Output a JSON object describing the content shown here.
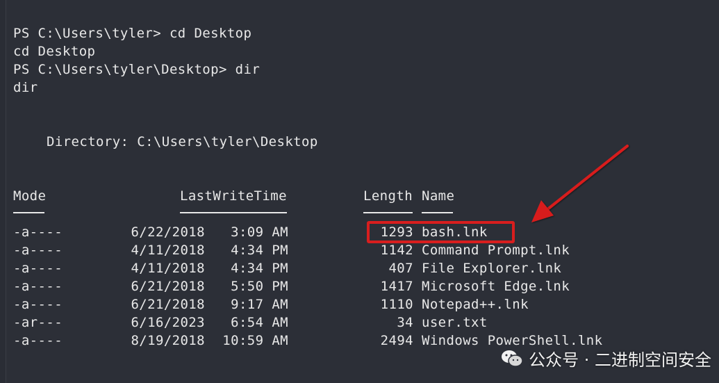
{
  "terminal": {
    "lines": [
      "PS C:\\Users\\tyler> cd Desktop",
      "cd Desktop",
      "PS C:\\Users\\tyler\\Desktop> dir",
      "dir",
      "Directory: C:\\Users\\tyler\\Desktop"
    ],
    "headers": {
      "mode": "Mode",
      "lastwrite": "LastWriteTime",
      "length": "Length",
      "name": "Name"
    },
    "rows": [
      {
        "mode": "-a----",
        "date": "6/22/2018",
        "time": "3:09 AM",
        "length": "1293",
        "name": "bash.lnk"
      },
      {
        "mode": "-a----",
        "date": "4/11/2018",
        "time": "4:34 PM",
        "length": "1142",
        "name": "Command Prompt.lnk"
      },
      {
        "mode": "-a----",
        "date": "4/11/2018",
        "time": "4:34 PM",
        "length": "407",
        "name": "File Explorer.lnk"
      },
      {
        "mode": "-a----",
        "date": "6/21/2018",
        "time": "5:50 PM",
        "length": "1417",
        "name": "Microsoft Edge.lnk"
      },
      {
        "mode": "-a----",
        "date": "6/21/2018",
        "time": "9:17 AM",
        "length": "1110",
        "name": "Notepad++.lnk"
      },
      {
        "mode": "-ar---",
        "date": "6/16/2023",
        "time": "6:54 AM",
        "length": "34",
        "name": "user.txt"
      },
      {
        "mode": "-a----",
        "date": "8/19/2018",
        "time": "10:59 AM",
        "length": "2494",
        "name": "Windows PowerShell.lnk"
      }
    ]
  },
  "annotation": {
    "box_color": "#d81e1e",
    "arrow_color": "#d81e1e",
    "highlighted_item": "bash.lnk"
  },
  "watermark": {
    "icon": "wechat-icon",
    "text": "公众号 · 二进制空间安全"
  }
}
